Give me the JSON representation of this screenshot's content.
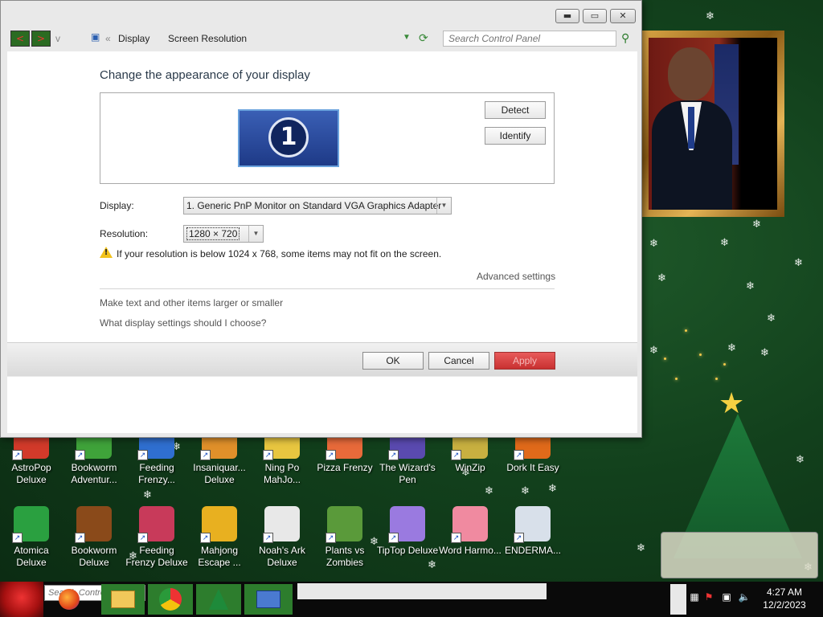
{
  "window": {
    "breadcrumb": [
      "Display",
      "Screen Resolution"
    ],
    "search_placeholder": "Search Control Panel",
    "heading": "Change the appearance of your display",
    "detect_label": "Detect",
    "identify_label": "Identify",
    "monitor_number": "1",
    "display_label": "Display:",
    "display_value": "1. Generic PnP Monitor on Standard VGA Graphics Adapter",
    "resolution_label": "Resolution:",
    "resolution_value": "1280 × 720",
    "warning_text": "If your resolution is below 1024 x 768, some items may not fit on the screen.",
    "advanced_link": "Advanced settings",
    "link_text_size": "Make text and other items larger or smaller",
    "link_help": "What display settings should I choose?",
    "ok_label": "OK",
    "cancel_label": "Cancel",
    "apply_label": "Apply"
  },
  "desktop": {
    "row1": [
      {
        "label": "AstroPop Deluxe",
        "color": "#d23a2a"
      },
      {
        "label": "Bookworm Adventur...",
        "color": "#3fa33a"
      },
      {
        "label": "Feeding Frenzy...",
        "color": "#2f6fd0"
      },
      {
        "label": "Insaniquar... Deluxe",
        "color": "#e0902a"
      },
      {
        "label": "Ning Po MahJo...",
        "color": "#e8c640"
      },
      {
        "label": "Pizza Frenzy",
        "color": "#e86a3a"
      },
      {
        "label": "The Wizard's Pen",
        "color": "#5a4ab0"
      },
      {
        "label": "WinZip",
        "color": "#c8b040"
      },
      {
        "label": "Dork It Easy",
        "color": "#e06a1a"
      }
    ],
    "row2": [
      {
        "label": "Atomica Deluxe",
        "color": "#2aa040"
      },
      {
        "label": "Bookworm Deluxe",
        "color": "#8a4a1a"
      },
      {
        "label": "Feeding Frenzy Deluxe",
        "color": "#c83a5a"
      },
      {
        "label": "Mahjong Escape ...",
        "color": "#e8b020"
      },
      {
        "label": "Noah's Ark Deluxe",
        "color": "#e8e8e8"
      },
      {
        "label": "Plants vs Zombies",
        "color": "#5a9a3a"
      },
      {
        "label": "TipTop Deluxe",
        "color": "#9a7ae0"
      },
      {
        "label": "Word Harmo...",
        "color": "#f08aa0"
      },
      {
        "label": "ENDERMA...",
        "color": "#d8e0ea"
      }
    ]
  },
  "taskbar": {
    "search_placeholder": "Search Control",
    "time": "4:27 AM",
    "date": "12/2/2023"
  }
}
